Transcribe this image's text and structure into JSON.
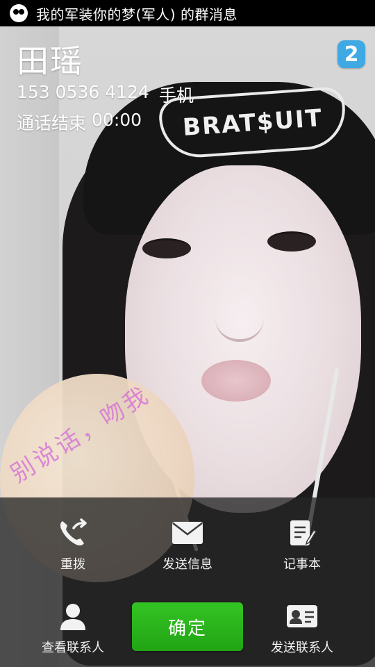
{
  "status_bar": {
    "notification_icon": "group-message-icon",
    "notification_text": "我的军装你的梦(军人) 的群消息"
  },
  "caller": {
    "name": "田瑶",
    "sim_badge": "2",
    "number": "153 0536 4124",
    "number_type": "手机",
    "call_status": "通话结束",
    "duration": "00:00"
  },
  "photo": {
    "beanie_text": "BRAT$UIT",
    "handwritten_text": "别说话，吻我"
  },
  "actions": {
    "redial": {
      "label": "重拨",
      "icon": "redial-phone-icon"
    },
    "send_sms": {
      "label": "发送信息",
      "icon": "envelope-icon"
    },
    "notepad": {
      "label": "记事本",
      "icon": "notepad-icon"
    },
    "view_contact": {
      "label": "查看联系人",
      "icon": "person-icon"
    },
    "send_contact": {
      "label": "发送联系人",
      "icon": "contact-card-icon"
    },
    "confirm": {
      "label": "确定"
    }
  },
  "colors": {
    "confirm_green": "#2bb51c",
    "sim_badge_blue": "#3fa9e4",
    "panel_bg": "#262626"
  }
}
